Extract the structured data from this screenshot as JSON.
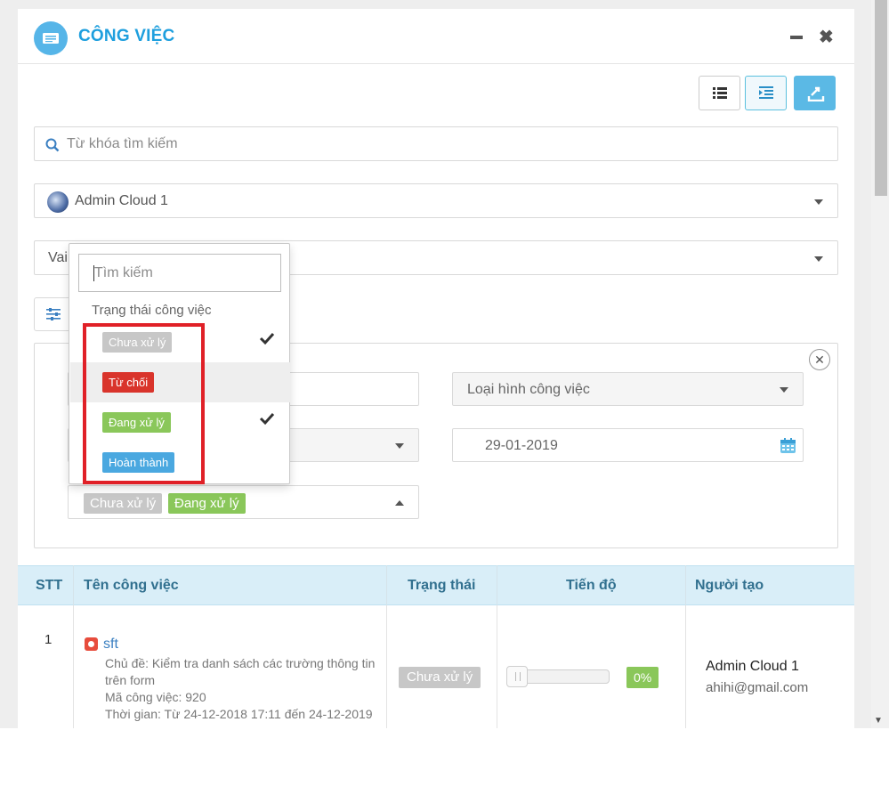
{
  "header": {
    "title": "CÔNG VIỆC"
  },
  "search": {
    "placeholder": "Từ khóa tìm kiếm"
  },
  "user_select": {
    "value": "Admin Cloud 1"
  },
  "role_select": {
    "value": "Vai"
  },
  "filter_panel": {
    "type_select_placeholder": "Loại hình công việc",
    "date_value": "29-01-2019",
    "selected_status_tags": [
      {
        "label": "Chưa xử lý",
        "color": "#c7c7c7"
      },
      {
        "label": "Đang xử lý",
        "color": "#8ac75a"
      }
    ]
  },
  "status_dropdown": {
    "search_placeholder": "Tìm kiếm",
    "group_label": "Trạng thái công việc",
    "items": [
      {
        "label": "Chưa xử lý",
        "color": "#c7c7c7",
        "checked": true
      },
      {
        "label": "Từ chối",
        "color": "#d9342b",
        "checked": false
      },
      {
        "label": "Đang xử lý",
        "color": "#8ac75a",
        "checked": true
      },
      {
        "label": "Hoàn thành",
        "color": "#4aa8e0",
        "checked": false
      }
    ]
  },
  "table": {
    "headers": [
      "STT",
      "Tên công việc",
      "Trạng thái",
      "Tiến độ",
      "Người tạo"
    ],
    "rows": [
      {
        "stt": "1",
        "name": "sft",
        "subject_line1": "Chủ đề: Kiểm tra danh sách các trường thông tin",
        "subject_line2": "trên form",
        "code": "Mã công việc: 920",
        "time": "Thời gian: Từ 24-12-2018 17:11 đến 24-12-2019",
        "status": "Chưa xử lý",
        "progress": 0,
        "progress_label": "0%",
        "creator_name": "Admin Cloud 1",
        "creator_email": "ahihi@gmail.com"
      }
    ]
  },
  "colors": {
    "accent": "#1e9fde",
    "highlight_box": "#e02027"
  }
}
